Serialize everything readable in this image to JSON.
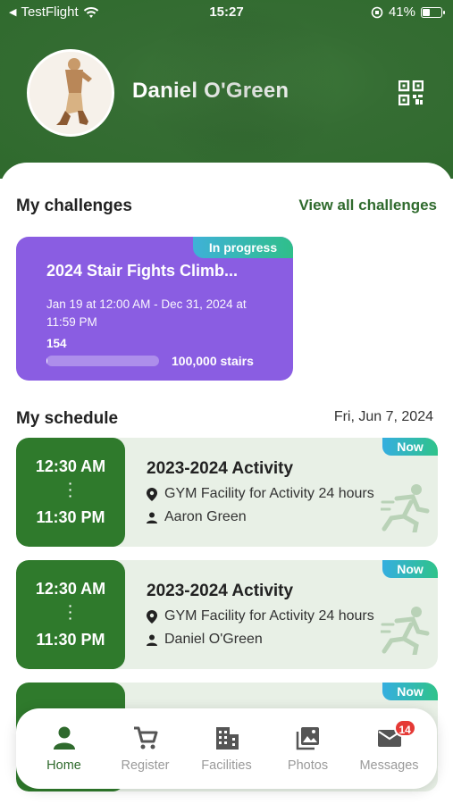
{
  "status_bar": {
    "back_label": "TestFlight",
    "time": "15:27",
    "battery": "41%",
    "battery_level": 0.41
  },
  "profile": {
    "name": "Daniel O'Green"
  },
  "challenges": {
    "title": "My challenges",
    "view_all": "View all challenges",
    "card": {
      "badge": "In progress",
      "title": "2024 Stair Fights Climb...",
      "dates": "Jan 19 at 12:00 AM - Dec 31, 2024 at 11:59 PM",
      "count": "154",
      "goal": "100,000 stairs",
      "progress": 0.00154
    }
  },
  "schedule": {
    "title": "My schedule",
    "date": "Fri, Jun 7, 2024",
    "items": [
      {
        "badge": "Now",
        "start": "12:30 AM",
        "end": "11:30 PM",
        "title": "2023-2024 Activity",
        "location": "GYM Facility for Activity 24 hours",
        "person": "Aaron Green"
      },
      {
        "badge": "Now",
        "start": "12:30 AM",
        "end": "11:30 PM",
        "title": "2023-2024 Activity",
        "location": "GYM Facility for Activity 24 hours",
        "person": "Daniel O'Green"
      },
      {
        "badge": "Now"
      }
    ]
  },
  "nav": {
    "items": [
      {
        "label": "Home",
        "icon": "person-icon"
      },
      {
        "label": "Register",
        "icon": "cart-icon"
      },
      {
        "label": "Facilities",
        "icon": "building-icon"
      },
      {
        "label": "Photos",
        "icon": "photos-icon"
      },
      {
        "label": "Messages",
        "icon": "mail-icon"
      }
    ],
    "messages_badge": "14"
  },
  "colors": {
    "brand_green": "#2f6a2d",
    "challenge_purple": "#8a5de2",
    "badge_red": "#e53935"
  }
}
